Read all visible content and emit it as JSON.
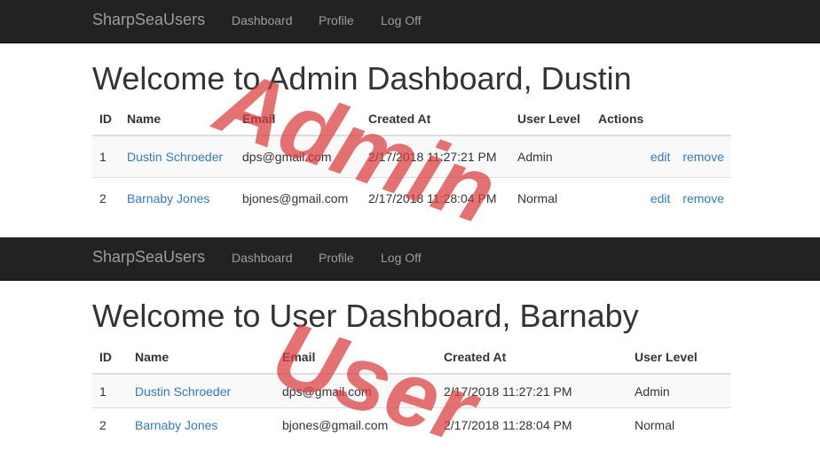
{
  "admin_view": {
    "brand": "SharpSeaUsers",
    "nav": [
      "Dashboard",
      "Profile",
      "Log Off"
    ],
    "title": "Welcome to Admin Dashboard, Dustin",
    "columns": [
      "ID",
      "Name",
      "Email",
      "Created At",
      "User Level",
      "Actions"
    ],
    "rows": [
      {
        "id": "1",
        "name": "Dustin Schroeder",
        "email": "dps@gmail.com",
        "created": "2/17/2018 11:27:21 PM",
        "level": "Admin",
        "edit": "edit",
        "remove": "remove"
      },
      {
        "id": "2",
        "name": "Barnaby Jones",
        "email": "bjones@gmail.com",
        "created": "2/17/2018 11:28:04 PM",
        "level": "Normal",
        "edit": "edit",
        "remove": "remove"
      }
    ],
    "watermark": "Admin"
  },
  "user_view": {
    "brand": "SharpSeaUsers",
    "nav": [
      "Dashboard",
      "Profile",
      "Log Off"
    ],
    "title": "Welcome to User Dashboard, Barnaby",
    "columns": [
      "ID",
      "Name",
      "Email",
      "Created At",
      "User Level"
    ],
    "rows": [
      {
        "id": "1",
        "name": "Dustin Schroeder",
        "email": "dps@gmail.com",
        "created": "2/17/2018 11:27:21 PM",
        "level": "Admin"
      },
      {
        "id": "2",
        "name": "Barnaby Jones",
        "email": "bjones@gmail.com",
        "created": "2/17/2018 11:28:04 PM",
        "level": "Normal"
      }
    ],
    "watermark": "User"
  },
  "colors": {
    "navbar": "#222222",
    "nav_text": "#9d9d9d",
    "link": "#337ab7",
    "watermark": "#da3c3c"
  }
}
